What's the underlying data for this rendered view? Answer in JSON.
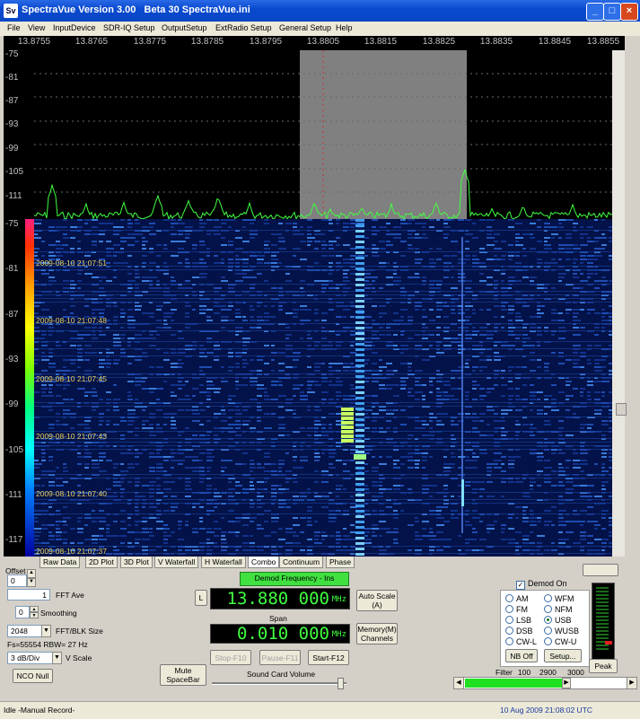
{
  "window": {
    "title": "SpectraVue Version 3.00   Beta 30 SpectraVue.ini",
    "icon_text": "Sv"
  },
  "menu": [
    "File",
    "View",
    "InputDevice",
    "SDR-IQ Setup",
    "OutputSetup",
    "ExtRadio Setup",
    "General Setup",
    "Help"
  ],
  "freq_ticks": [
    "13.8755",
    "13.8765",
    "13.8775",
    "13.8785",
    "13.8795",
    "13.8805",
    "13.8815",
    "13.8825",
    "13.8835",
    "13.8845",
    "13.8855"
  ],
  "spectrum_db": [
    "-75",
    "-81",
    "-87",
    "-93",
    "-99",
    "-105",
    "-111"
  ],
  "waterfall_db": [
    "-75",
    "-81",
    "-87",
    "-93",
    "-99",
    "-105",
    "-111",
    "-117"
  ],
  "timestamps": [
    "2009-08-10 21:07:51",
    "2009-08-10 21:07:48",
    "2009-08-10 21:07:45",
    "2009-08-10 21:07:43",
    "2009-08-10 21:07:40",
    "2009-08-10 21:07:37"
  ],
  "tabs": [
    "Raw Data",
    "2D Plot",
    "3D Plot",
    "V Waterfall",
    "H Waterfall",
    "Combo",
    "Continuum",
    "Phase"
  ],
  "active_tab": "Combo",
  "left": {
    "offset_label": "Offset",
    "offset_value": "0",
    "fft_ave_value": "1",
    "fft_ave_label": "FFT Ave",
    "smoothing_value": "0",
    "smoothing_label": "Smoothing",
    "fft_size_value": "2048",
    "fft_size_label": "FFT/BLK Size",
    "fs_info": "Fs=55554 RBW=  27 Hz",
    "vscale_value": "3 dB/Div",
    "vscale_label": "V Scale",
    "nco_null": "NCO Null"
  },
  "center": {
    "demod_label": "Demod Frequency - Ins",
    "l_button": "L",
    "demod_freq": "13.880 000",
    "freq_unit": "MHz",
    "span_label": "Span",
    "span_value": "0.010 000",
    "auto_scale": "Auto Scale (A)",
    "memory": "Memory(M) Channels",
    "stop": "Stop-F10",
    "pause": "Pause-F11",
    "start": "Start-F12",
    "mute": "Mute SpaceBar",
    "volume_label": "Sound Card Volume",
    "volume_level": 0.95
  },
  "demod": {
    "demod_on_label": "Demod On",
    "demod_on": true,
    "modes": [
      "AM",
      "WFM",
      "FM",
      "NFM",
      "LSB",
      "USB",
      "DSB",
      "WUSB",
      "CW-L",
      "CW-U"
    ],
    "selected": "USB",
    "nb_off": "NB Off",
    "setup": "Setup...",
    "filter_label": "Filter",
    "filter_values": [
      "100",
      "2900",
      "3000"
    ],
    "peak": "Peak"
  },
  "status": {
    "left": "Idle -Manual Record-",
    "right": "10 Aug 2009  21:08:02 UTC"
  },
  "colors": {
    "spectrum_line": "#40ff40",
    "passband": "#808080",
    "passband_bar": "#20e020",
    "waterfall_bg": "#031248",
    "lcd_text": "#40ff40"
  }
}
